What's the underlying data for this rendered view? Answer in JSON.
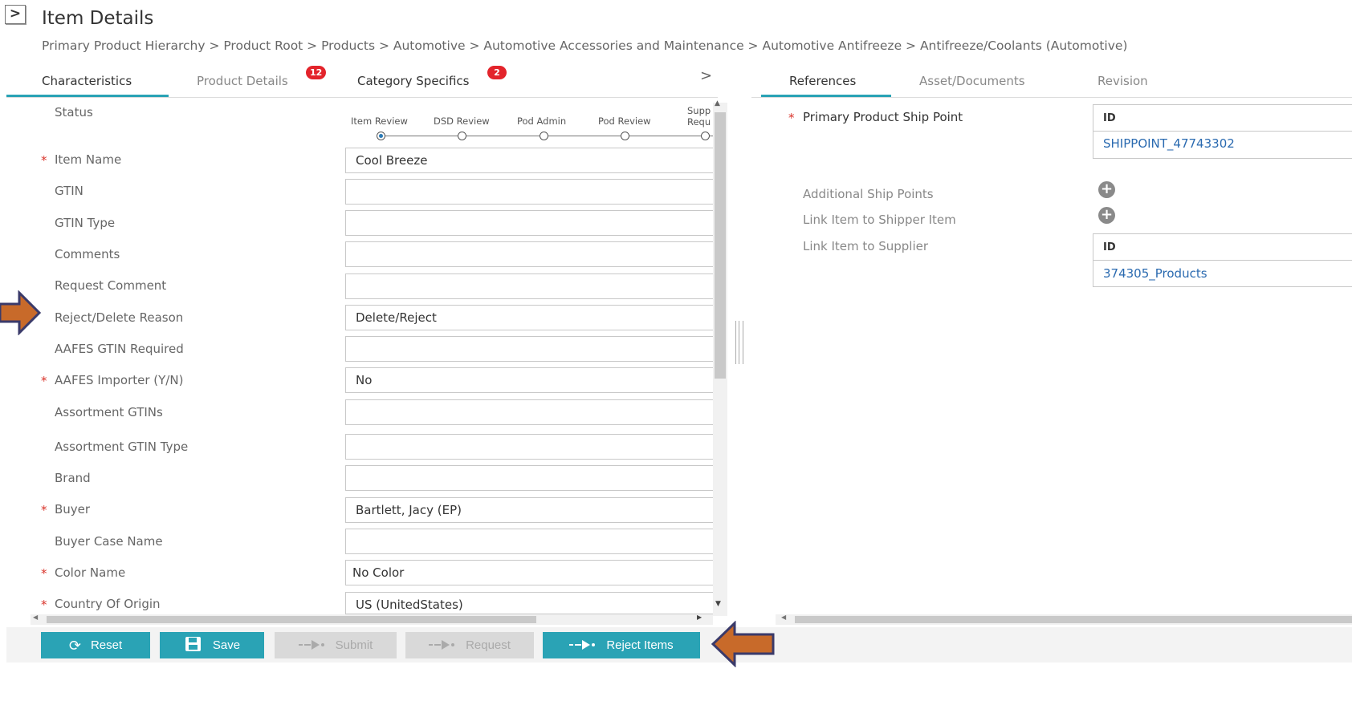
{
  "header": {
    "toggle_icon": ">",
    "title": "Item Details",
    "breadcrumb": "Primary Product Hierarchy > Product Root > Products > Automotive > Automotive Accessories and Maintenance > Automotive Antifreeze > Antifreeze/Coolants (Automotive)"
  },
  "left_tabs": [
    {
      "label": "Characteristics",
      "active": true
    },
    {
      "label": "Product Details",
      "badge": "12"
    },
    {
      "label": "Category Specifics",
      "badge": "2"
    }
  ],
  "left_tabs_chevron": ">",
  "status": {
    "label": "Status",
    "steps": [
      "Item Review",
      "DSD Review",
      "Pod Admin",
      "Pod Review",
      "Supp",
      "Requ"
    ],
    "active_step": "Item Review"
  },
  "fields": [
    {
      "label": "Item Name",
      "required": true,
      "value": "Cool Breeze"
    },
    {
      "label": "GTIN",
      "required": false,
      "value": ""
    },
    {
      "label": "GTIN Type",
      "required": false,
      "value": ""
    },
    {
      "label": "Comments",
      "required": false,
      "value": ""
    },
    {
      "label": "Request Comment",
      "required": false,
      "value": ""
    },
    {
      "label": "Reject/Delete Reason",
      "required": false,
      "value": "Delete/Reject"
    },
    {
      "label": "AAFES GTIN Required",
      "required": false,
      "value": ""
    },
    {
      "label": "AAFES Importer (Y/N)",
      "required": true,
      "value": "No"
    },
    {
      "label": "Assortment GTINs",
      "required": false,
      "value": ""
    },
    {
      "label": "Assortment GTIN Type",
      "required": false,
      "value": ""
    },
    {
      "label": "Brand",
      "required": false,
      "value": ""
    },
    {
      "label": "Buyer",
      "required": true,
      "value": "Bartlett, Jacy (EP)"
    },
    {
      "label": "Buyer Case Name",
      "required": false,
      "value": ""
    },
    {
      "label": "Color Name",
      "required": true,
      "value": "No Color"
    },
    {
      "label": "Country Of Origin",
      "required": true,
      "value": "US (UnitedStates)"
    }
  ],
  "required_mark": "*",
  "buttons": {
    "reset": "Reset",
    "save": "Save",
    "submit": "Submit",
    "request": "Request",
    "reject": "Reject Items"
  },
  "right_tabs": [
    {
      "label": "References",
      "active": true
    },
    {
      "label": "Asset/Documents"
    },
    {
      "label": "Revision"
    }
  ],
  "references": {
    "primary_ship_point": {
      "label": "Primary Product Ship Point",
      "column": "ID",
      "value": "SHIPPOINT_47743302"
    },
    "additional_ship_points": {
      "label": "Additional Ship Points"
    },
    "link_shipper_item": {
      "label": "Link Item to Shipper Item"
    },
    "link_supplier": {
      "label": "Link Item to Supplier",
      "column": "ID",
      "value": "374305_Products"
    }
  },
  "colors": {
    "accent": "#2aa3b5",
    "badge": "#e3242b",
    "required": "#d9342b",
    "link": "#2a6ab0",
    "annotation_arrow": "#c86a2a",
    "annotation_outline": "#3a3a6a"
  }
}
